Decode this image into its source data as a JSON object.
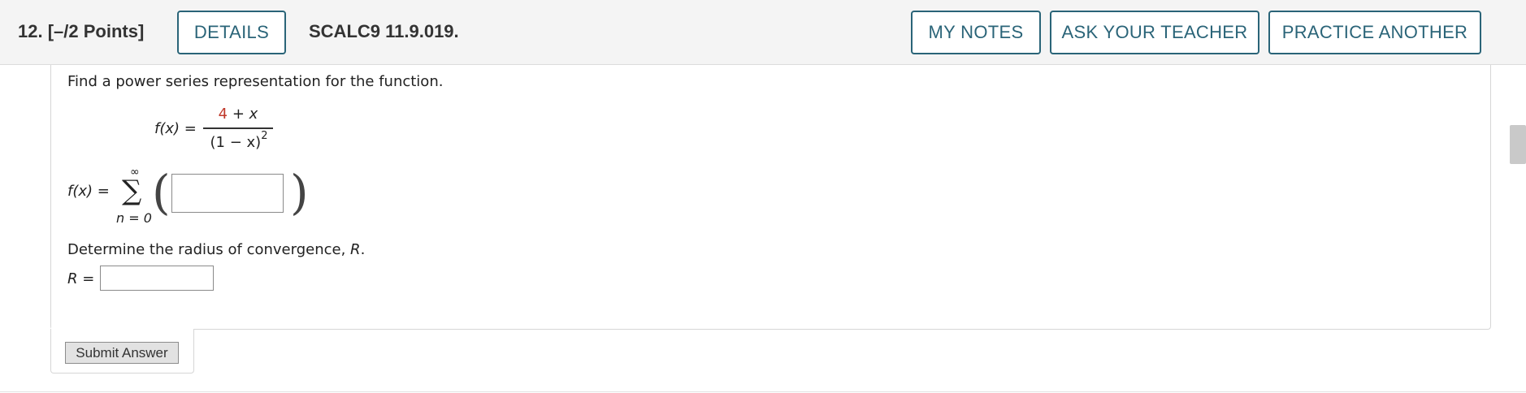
{
  "header": {
    "question_number": "12.",
    "points": "[–/2 Points]",
    "details_label": "DETAILS",
    "assignment_code": "SCALC9 11.9.019.",
    "my_notes_label": "MY NOTES",
    "ask_teacher_label": "ASK YOUR TEACHER",
    "practice_another_label": "PRACTICE ANOTHER"
  },
  "question": {
    "prompt": "Find a power series representation for the function.",
    "function": {
      "lhs": "f(x) =",
      "numerator_constant": "4",
      "numerator_rest": " + x",
      "denominator": "(1 − x)",
      "denominator_exponent": "2"
    },
    "series": {
      "lhs": "f(x) =",
      "sum_upper": "∞",
      "sum_symbol": "∑",
      "sum_lower": "n = 0",
      "term_value": ""
    },
    "radius_prompt_start": "Determine the radius of convergence, ",
    "radius_variable": "R",
    "radius_prompt_end": ".",
    "radius_label": "R =",
    "radius_value": ""
  },
  "actions": {
    "submit_label": "Submit Answer"
  },
  "colors": {
    "accent": "#2a6478",
    "highlight_red": "#c0392b"
  }
}
